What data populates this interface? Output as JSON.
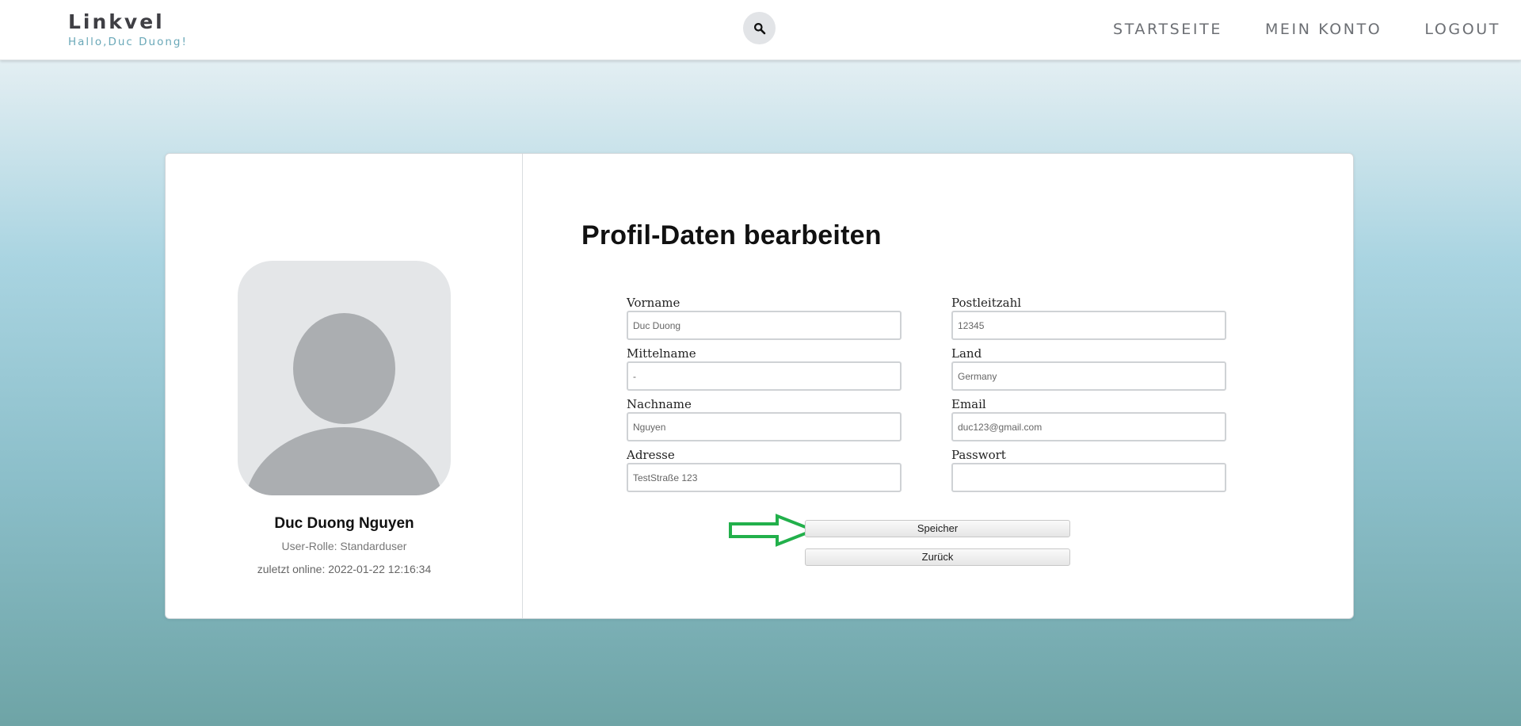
{
  "header": {
    "brand": "Linkvel",
    "greeting": "Hallo,Duc Duong!",
    "nav": [
      "STARTSEITE",
      "MEIN KONTO",
      "LOGOUT"
    ]
  },
  "profile": {
    "name": "Duc Duong Nguyen",
    "role": "User-Rolle: Standarduser",
    "last_online": "zuletzt online: 2022-01-22 12:16:34"
  },
  "form": {
    "title": "Profil-Daten bearbeiten",
    "fields": [
      {
        "label": "Vorname",
        "value": "Duc Duong"
      },
      {
        "label": "Mittelname",
        "value": "-"
      },
      {
        "label": "Nachname",
        "value": "Nguyen"
      },
      {
        "label": "Adresse",
        "value": "TestStraße 123"
      },
      {
        "label": "Postleitzahl",
        "value": "12345"
      },
      {
        "label": "Land",
        "value": "Germany"
      },
      {
        "label": "Email",
        "value": "duc123@gmail.com"
      },
      {
        "label": "Passwort",
        "value": ""
      }
    ],
    "save_label": "Speicher",
    "back_label": "Zurück"
  },
  "colors": {
    "brand_accent": "#6aa8b8",
    "arrow": "#22b04b"
  },
  "icons": {
    "search": "search-icon",
    "avatar": "user-avatar-placeholder",
    "arrow": "arrow-right-icon"
  }
}
